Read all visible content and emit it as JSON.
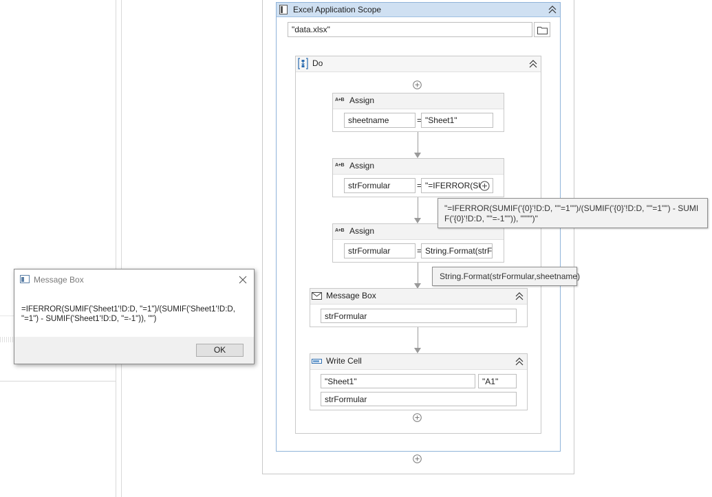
{
  "scope": {
    "title": "Excel Application Scope",
    "path_value": "\"data.xlsx\"",
    "icons": {
      "activity": "excel-scope-icon",
      "collapse": "collapse-chevron-icon",
      "browse": "folder-icon"
    }
  },
  "do": {
    "title": "Do",
    "icon": "sequence-icon"
  },
  "assign1": {
    "title": "Assign",
    "icon": "assign-icon",
    "to": "sheetname",
    "eq": "=",
    "value": "\"Sheet1\""
  },
  "assign2": {
    "title": "Assign",
    "icon": "assign-icon",
    "to": "strFormular",
    "eq": "=",
    "value": "\"=IFERROR(SU"
  },
  "assign3": {
    "title": "Assign",
    "icon": "assign-icon",
    "to": "strFormular",
    "eq": "=",
    "value": "String.Format(strFo"
  },
  "tooltip1": {
    "text": "\"=IFERROR(SUMIF('{0}'!D:D, \"\"=1\"\")/(SUMIF('{0}'!D:D, \"\"=1\"\") - SUMIF('{0}'!D:D, \"\"=-1\"\")), \"\"\"\")\""
  },
  "tooltip2": {
    "text": "String.Format(strFormular,sheetname)"
  },
  "msgbox_activity": {
    "title": "Message Box",
    "icon": "envelope-icon",
    "value": "strFormular"
  },
  "writecell": {
    "title": "Write Cell",
    "icon": "write-cell-icon",
    "sheet": "\"Sheet1\"",
    "cell": "\"A1\"",
    "value": "strFormular"
  },
  "dialog": {
    "title": "Message Box",
    "message": "=IFERROR(SUMIF('Sheet1'!D:D, \"=1\")/(SUMIF('Sheet1'!D:D, \"=1\") - SUMIF('Sheet1'!D:D, \"=-1\")), \"\")",
    "ok_label": "OK",
    "icons": {
      "app": "window-icon",
      "close": "close-icon"
    }
  },
  "colors": {
    "scope_header": "#cfe0f2",
    "scope_border": "#8fb3d9",
    "tooltip_bg": "#f2f2f2"
  }
}
